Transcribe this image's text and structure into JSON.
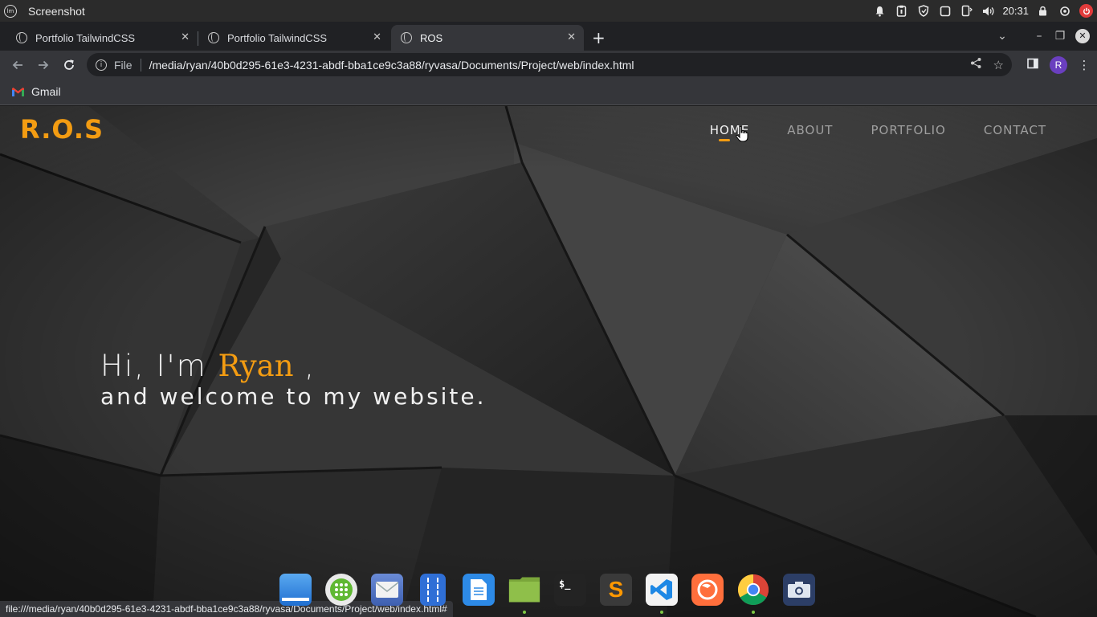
{
  "os": {
    "app_title": "Screenshot",
    "clock": "20:31",
    "tray_icons": [
      "bell-icon",
      "clipboard-icon",
      "shield-icon",
      "window-icon",
      "battery-phone-icon",
      "volume-icon"
    ]
  },
  "browser": {
    "tabs": [
      {
        "title": "Portfolio TailwindCSS",
        "active": false
      },
      {
        "title": "Portfolio TailwindCSS",
        "active": false
      },
      {
        "title": "ROS",
        "active": true
      }
    ],
    "address": {
      "scheme_label": "File",
      "url": "/media/ryan/40b0d295-61e3-4231-abdf-bba1ce9c3a88/ryvasa/Documents/Project/web/index.html"
    },
    "profile_initial": "R",
    "bookmarks": [
      {
        "label": "Gmail"
      }
    ],
    "status_url": "file:///media/ryan/40b0d295-61e3-4231-abdf-bba1ce9c3a88/ryvasa/Documents/Project/web/index.html#"
  },
  "site": {
    "logo": "R.O.S",
    "nav": [
      {
        "label": "HOME",
        "active": true
      },
      {
        "label": "ABOUT",
        "active": false
      },
      {
        "label": "PORTFOLIO",
        "active": false
      },
      {
        "label": "CONTACT",
        "active": false
      }
    ],
    "hero": {
      "greeting": "Hi, I'm",
      "name": "Ryan",
      "comma": ",",
      "subtitle": "and welcome to my website."
    },
    "accent_color": "#f39c12"
  },
  "dock": {
    "apps": [
      "finder-icon",
      "app-grid-icon",
      "mail-icon",
      "file-archive-icon",
      "document-icon",
      "files-folder-icon",
      "terminal-icon",
      "sublime-text-icon",
      "vscode-icon",
      "firefox-icon",
      "chrome-icon",
      "camera-icon"
    ]
  }
}
